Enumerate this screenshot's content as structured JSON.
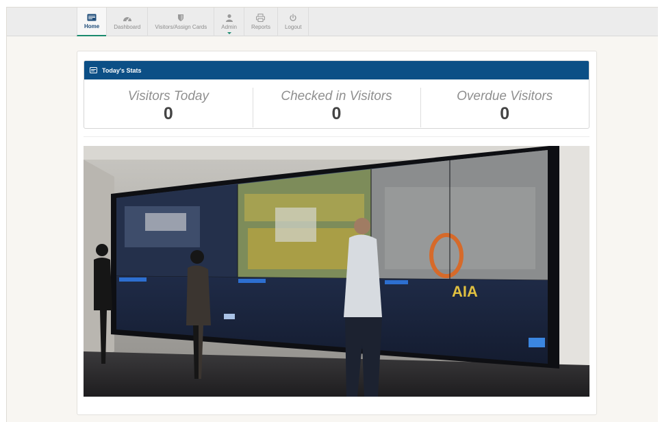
{
  "nav": {
    "items": [
      {
        "label": "Home",
        "icon": "id-card-icon",
        "active": true
      },
      {
        "label": "Dashboard",
        "icon": "dashboard-icon",
        "active": false
      },
      {
        "label": "Visitors/Assign Cards",
        "icon": "shield-icon",
        "active": false
      },
      {
        "label": "Admin",
        "icon": "user-icon",
        "active": false,
        "has_dropdown": true
      },
      {
        "label": "Reports",
        "icon": "printer-icon",
        "active": false
      },
      {
        "label": "Logout",
        "icon": "power-icon",
        "active": false
      }
    ]
  },
  "stats": {
    "title": "Today's Stats",
    "header_icon": "id-card-icon",
    "items": [
      {
        "label": "Visitors Today",
        "value": "0"
      },
      {
        "label": "Checked in Visitors",
        "value": "0"
      },
      {
        "label": "Overdue Visitors",
        "value": "0"
      }
    ]
  },
  "hero_image": {
    "description_icon": "video-wall-photo",
    "screen_text": "AIA"
  },
  "colors": {
    "header_blue": "#0c4f86",
    "active_underline": "#1a8a6e",
    "page_background": "#f8f6f2"
  }
}
